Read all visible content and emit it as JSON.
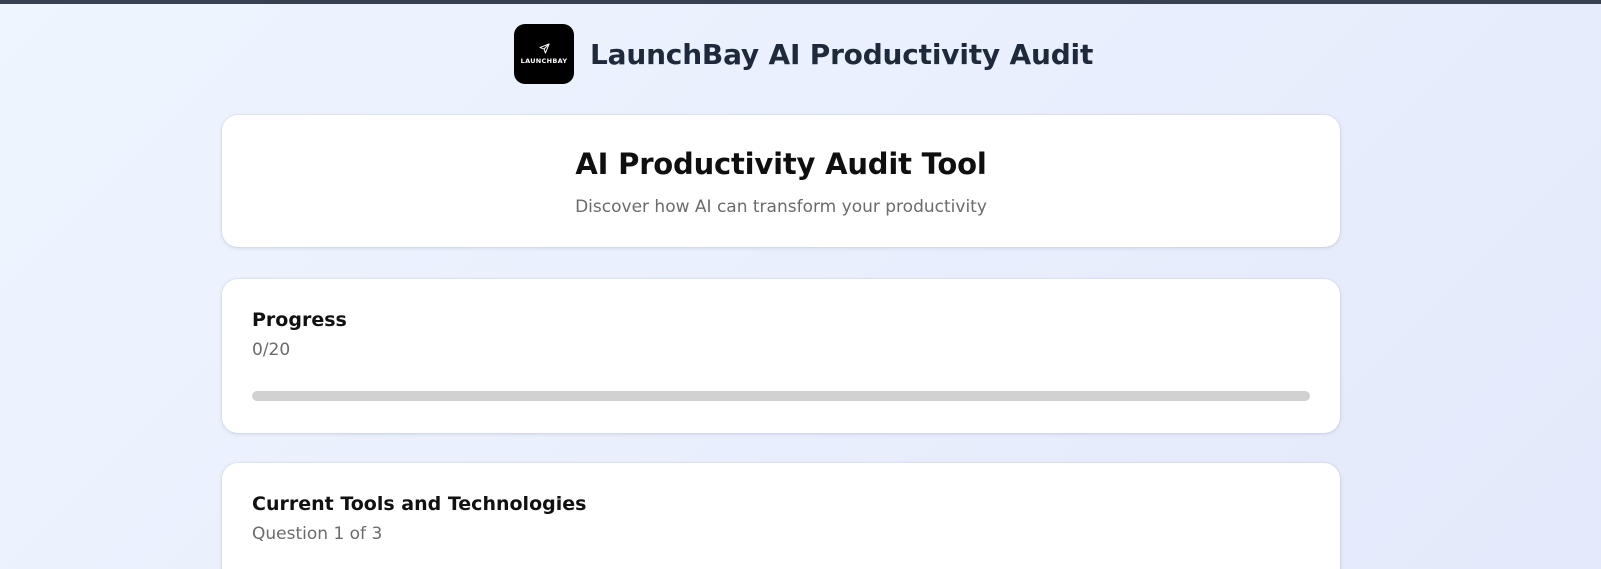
{
  "app": {
    "title": "LaunchBay AI Productivity Audit",
    "logo_text": "LAUNCHBAY"
  },
  "hero": {
    "title": "AI Productivity Audit Tool",
    "subtitle": "Discover how AI can transform your productivity"
  },
  "progress": {
    "label": "Progress",
    "count_text": "0/20",
    "answered": 0,
    "total": 20,
    "fill_fraction": 0
  },
  "question": {
    "section_title": "Current Tools and Technologies",
    "counter_text": "Question 1 of 3"
  },
  "icons": {
    "logo": "paper-plane-icon"
  },
  "colors": {
    "topbar": "#374151",
    "logo_bg": "#000000",
    "progress_track": "#d1d1d1",
    "progress_fill": "#3b82f6",
    "title_text": "#1e293b"
  }
}
